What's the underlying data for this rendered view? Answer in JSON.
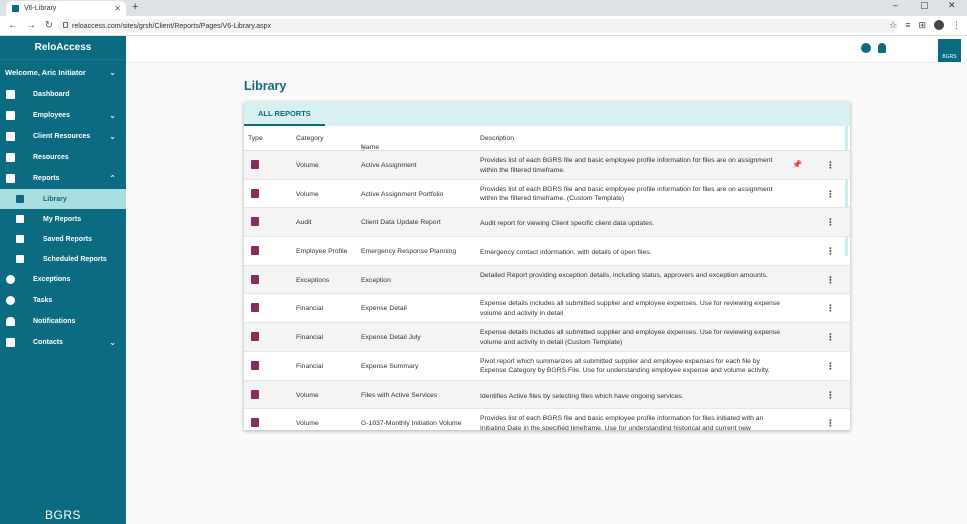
{
  "browser": {
    "tab_title": "V6-Library",
    "url": "reloaccess.com/sites/grsh/Client/Reports/Pages/V6-Library.aspx"
  },
  "sidebar": {
    "brand": "ReloAccess",
    "welcome": "Welcome, Aric Initiator",
    "items": [
      {
        "label": "Dashboard",
        "icon": "dashboard-icon"
      },
      {
        "label": "Employees",
        "icon": "people-icon",
        "chevron": "down"
      },
      {
        "label": "Client Resources",
        "icon": "books-icon",
        "chevron": "down"
      },
      {
        "label": "Resources",
        "icon": "book-icon"
      },
      {
        "label": "Reports",
        "icon": "reports-icon",
        "chevron": "up"
      }
    ],
    "sub_items": [
      {
        "label": "Library",
        "active": true
      },
      {
        "label": "My Reports"
      },
      {
        "label": "Saved Reports"
      },
      {
        "label": "Scheduled Reports"
      }
    ],
    "items_after": [
      {
        "label": "Exceptions",
        "icon": "exclamation-icon"
      },
      {
        "label": "Tasks",
        "icon": "check-circle-icon"
      },
      {
        "label": "Notifications",
        "icon": "bell-icon"
      },
      {
        "label": "Contacts",
        "icon": "contacts-icon",
        "chevron": "down"
      }
    ],
    "footer_logo": "BGRS"
  },
  "topbar": {
    "user_badge": "BGRS"
  },
  "main": {
    "title": "Library",
    "tab": "ALL REPORTS",
    "columns": {
      "type": "Type",
      "category": "Category",
      "name": "Name",
      "description": "Description"
    },
    "rows": [
      {
        "category": "Volume",
        "name": "Active Assignment",
        "description": "Provides list of each BGRS file and basic employee profile information for files are on assignment within the filtered timeframe."
      },
      {
        "category": "Volume",
        "name": "Active Assignment Portfolio",
        "description": "Provides list of each BGRS file and basic employee profile information for files are on assignment within the filtered timeframe. (Custom Template)"
      },
      {
        "category": "Audit",
        "name": "Client Data Update Report",
        "description": "Audit report for viewing Client specific client data updates."
      },
      {
        "category": "Employee Profile",
        "name": "Emergency Response Planning",
        "description": "Emergency contact information, with details of open files."
      },
      {
        "category": "Exceptions",
        "name": "Exception",
        "description": "Detailed Report providing exception details, including status, approvers and exception amounts."
      },
      {
        "category": "Financial",
        "name": "Expense Detail",
        "description": "Expense details includes all submitted supplier and employee expenses. Use for reviewing expense volume and activity in detail"
      },
      {
        "category": "Financial",
        "name": "Expense Detail July",
        "description": "Expense details includes all submitted supplier and employee expenses. Use for reviewing expense volume and activity in detail (Custom Template)"
      },
      {
        "category": "Financial",
        "name": "Expense Summary",
        "description": "Pivot report which summarizes all submitted supplier and employee expenses for each file by Expense Category by BGRS File. Use for understanding employee expense and volume activity."
      },
      {
        "category": "Volume",
        "name": "Files with Active Services",
        "description": "Identifies Active files by selecting files which have ongoing services."
      },
      {
        "category": "Volume",
        "name": "G-1037-Monthly Initiation Volume",
        "description": "Provides list of each BGRS file and basic employee profile information for files initiated with an Initiating Date in the specified timeframe. Use for understanding historical and current new"
      }
    ]
  }
}
